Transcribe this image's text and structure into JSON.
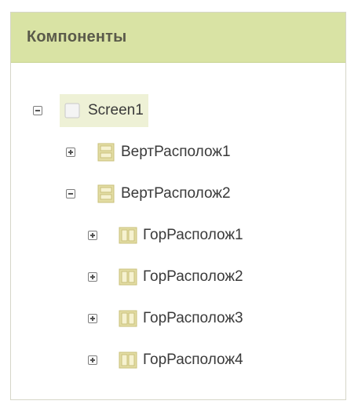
{
  "panel": {
    "title": "Компоненты"
  },
  "tree": {
    "screen": {
      "label": "Screen1",
      "icon": "screen-icon",
      "expanded": true,
      "selected": true
    },
    "vert1": {
      "label": "ВертРасполож1",
      "icon": "vertical-arrangement-icon",
      "expanded": false
    },
    "vert2": {
      "label": "ВертРасполож2",
      "icon": "vertical-arrangement-icon",
      "expanded": true
    },
    "hor1": {
      "label": "ГорРасполож1",
      "icon": "horizontal-arrangement-icon",
      "expanded": false
    },
    "hor2": {
      "label": "ГорРасполож2",
      "icon": "horizontal-arrangement-icon",
      "expanded": false
    },
    "hor3": {
      "label": "ГорРасполож3",
      "icon": "horizontal-arrangement-icon",
      "expanded": false
    },
    "hor4": {
      "label": "ГорРасполож4",
      "icon": "horizontal-arrangement-icon",
      "expanded": false
    }
  },
  "colors": {
    "header_bg": "#d9e3a4",
    "selection_bg": "#eef1d6",
    "icon_fill": "#e3dda4",
    "text": "#3a3a3a"
  }
}
